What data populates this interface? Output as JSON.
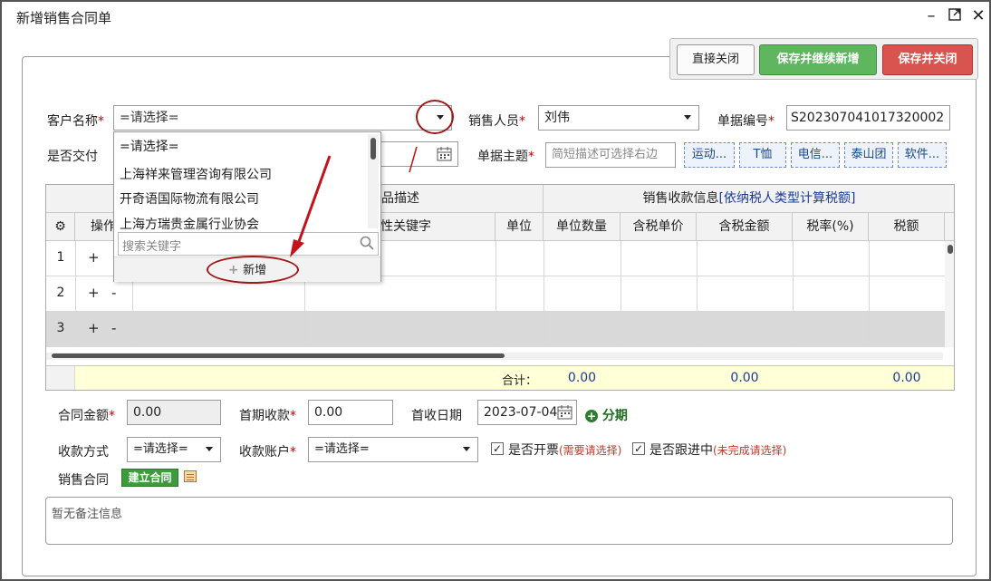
{
  "window": {
    "title": "新增销售合同单"
  },
  "toolbar": {
    "close": "直接关闭",
    "save_new": "保存并继续新增",
    "save_close": "保存并关闭"
  },
  "form": {
    "customer": {
      "label": "客户名称",
      "placeholder": "=请选择="
    },
    "salesperson": {
      "label": "销售人员",
      "value": "刘伟"
    },
    "doc_no": {
      "label": "单据编号",
      "value": "S202307041017320002"
    },
    "delivered": {
      "label": "是否交付"
    },
    "subject": {
      "label": "单据主题",
      "placeholder": "简短描述可选择右边"
    },
    "subject_tags": [
      "运动...",
      "T恤",
      "电信...",
      "泰山团",
      "软件..."
    ]
  },
  "dropdown": {
    "items": [
      "=请选择=",
      "上海祥来管理咨询有限公司",
      "开奇语国际物流有限公司",
      "上海方瑞贵金属行业协会"
    ],
    "search_placeholder": "搜索关键字",
    "add_label": "新增"
  },
  "table": {
    "group_headers": {
      "product": "商品描述",
      "sales": "销售收款信息",
      "sales_note": "[依纳税人类型计算税额]"
    },
    "columns": {
      "op": "操作",
      "attr": "属性关键字",
      "unit": "单位",
      "qty": "单位数量",
      "price": "含税单价",
      "amount": "含税金额",
      "rate": "税率(%)",
      "tax": "税额"
    },
    "rows": [
      "1",
      "2",
      "3"
    ],
    "plus": "+",
    "minus": "-",
    "footer": {
      "label": "合计：",
      "qty": "0.00",
      "amount": "0.00",
      "tax": "0.00"
    }
  },
  "payment": {
    "contract_amount": {
      "label": "合同金额",
      "value": "0.00"
    },
    "first_payment": {
      "label": "首期收款",
      "value": "0.00"
    },
    "first_date": {
      "label": "首收日期",
      "value": "2023-07-04"
    },
    "installment": "分期",
    "method": {
      "label": "收款方式",
      "placeholder": "=请选择="
    },
    "account": {
      "label": "收款账户",
      "placeholder": "=请选择="
    },
    "invoice": {
      "label": "是否开票",
      "hint": "(需要请选择)"
    },
    "follow": {
      "label": "是否跟进中",
      "hint": "(未完成请选择)"
    },
    "contract": {
      "label": "销售合同",
      "button": "建立合同"
    }
  },
  "remark": {
    "text": "暂无备注信息"
  },
  "colors": {
    "accent_red": "#c00000",
    "green": "#5fb65f",
    "red": "#d9534f",
    "link_blue": "#1a3a9a"
  }
}
